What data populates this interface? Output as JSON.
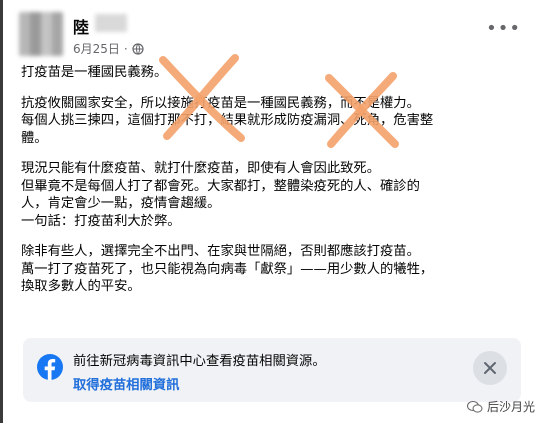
{
  "post": {
    "author": "陸",
    "date": "6月25日",
    "paragraphs": [
      [
        "打疫苗是一種國民義務。"
      ],
      [
        "抗疫攸關國家安全，所以接施打疫苗是一種國民義務，而不是權力。",
        "每個人挑三揀四，這個打那不打，結果就形成防疫漏洞、死角，危害整",
        "體。"
      ],
      [
        "現況只能有什麼疫苗、就打什麼疫苗，即使有人會因此致死。",
        "但畢竟不是每個人打了都會死。大家都打，整體染疫死的人、確診的",
        "人，肯定會少一點，疫情會趨緩。",
        "一句話：打疫苗利大於弊。"
      ],
      [
        "除非有些人，選擇完全不出門、在家與世隔絕，否則都應該打疫苗。",
        "萬一打了疫苗死了，也只能視為向病毒「獻祭」——用少數人的犧牲，",
        "換取多數人的平安。"
      ]
    ]
  },
  "info_card": {
    "title": "前往新冠病毒資訊中心查看疫苗相關資源。",
    "link": "取得疫苗相關資訊"
  },
  "watermark": {
    "text": "后沙月光"
  },
  "icons": {
    "facebook": "facebook-icon",
    "globe": "globe-icon",
    "close": "close-icon",
    "more": "more-icon",
    "cross_mark": "orange-x-mark"
  },
  "colors": {
    "cross": "#f4a26a",
    "link": "#216fdb",
    "facebook": "#1877f2",
    "card_bg": "#f0f2f5"
  }
}
